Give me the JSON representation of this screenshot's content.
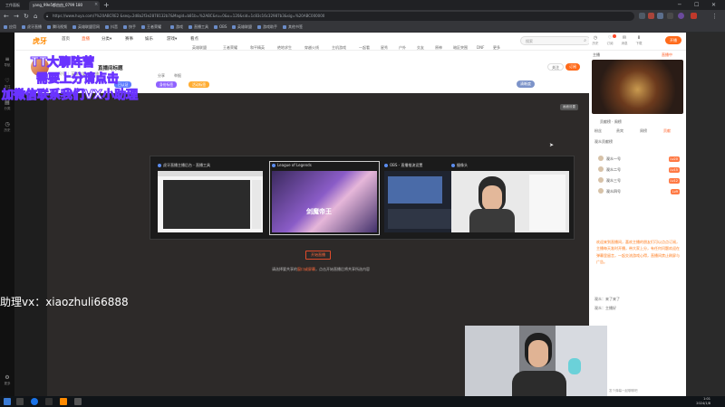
{
  "browser": {
    "tabs": [
      {
        "label": "工作面板"
      },
      {
        "label": "yang_99e5都由由_0799 180"
      }
    ],
    "new_tab": "+",
    "window_controls": {
      "min": "─",
      "max": "☐",
      "close": "✕"
    },
    "url": "https://www.huya.com/?%20ABCRE2 &seq=2d8a2f3e2878132b7&Magid=b81b=%2ABC&ru=0&u=120&sid=1c83c16c32987b3&sig=%20ABC000000",
    "nav": {
      "back": "←",
      "forward": "→",
      "reload": "↻",
      "home": "⌂"
    }
  },
  "bookmarks": [
    "应用",
    "虎牙直播",
    "腾讯视频",
    "英雄联盟官网",
    "抖音",
    "快手",
    "王者荣耀",
    "游戏",
    "直播工具",
    "OBS",
    "英雄联盟",
    "游戏助手",
    "其他书签"
  ],
  "leftrail": {
    "items": [
      {
        "icon": "≡",
        "label": "导航"
      },
      {
        "icon": "♡",
        "label": "关注"
      },
      {
        "icon": "▤",
        "label": "分类"
      },
      {
        "icon": "◷",
        "label": "历史"
      }
    ],
    "bottom": {
      "icon": "⚙",
      "label": "更多"
    }
  },
  "site": {
    "logo": "虎牙",
    "nav": [
      {
        "label": "首页"
      },
      {
        "label": "直播",
        "hot": true
      },
      {
        "label": "分类▾"
      },
      {
        "label": "赛事"
      },
      {
        "label": "娱乐"
      },
      {
        "label": "游戏▾"
      },
      {
        "label": "看点"
      }
    ],
    "categories": [
      "英雄联盟",
      "王者荣耀",
      "和平精英",
      "绝地求生",
      "穿越火线",
      "主机游戏",
      "一起看",
      "星秀",
      "户外",
      "交友",
      "原神",
      "暗区突围",
      "DNF",
      "更多"
    ],
    "search_placeholder": "搜索",
    "search_icon": "⌕",
    "top_icons": [
      {
        "glyph": "◷",
        "label": "历史"
      },
      {
        "glyph": "♡",
        "label": "订阅"
      },
      {
        "glyph": "✉",
        "label": "消息"
      },
      {
        "glyph": "⬇",
        "label": "下载"
      }
    ],
    "open_live": "开播",
    "login": "登录"
  },
  "room": {
    "title": "直播间标题",
    "meta": "房间号 ｜ 英雄联盟 ｜ 主播",
    "badges": [
      {
        "label": "已认证",
        "color": "#5b7cff"
      },
      {
        "label": "身份标签",
        "color": "#8f62ff"
      },
      {
        "label": "活动标签",
        "color": "#ffad33"
      }
    ],
    "actions": [
      "分享",
      "举报"
    ],
    "follow": "订阅",
    "subscribe": "关注",
    "stats": "清晰度"
  },
  "player": {
    "corner_label": "画面设置",
    "windows": [
      {
        "title": "虎牙直播主播后台 - 直播工具",
        "selected": false
      },
      {
        "title": "League of Legends",
        "selected": true
      },
      {
        "title": "OBS - 直播推流设置",
        "selected": false
      },
      {
        "title": "摄像头",
        "selected": false
      }
    ],
    "thumb_text": "剑魔帝王",
    "start_button": "开始直播",
    "hint_prefix": "请选择要共享的",
    "hint_highlight": "窗口或屏幕",
    "hint_suffix": "，点击开始直播后将共享所选内容"
  },
  "rightcol": {
    "top_row": [
      "主播",
      "直播中"
    ],
    "rank_header": "贡献榜 · 周榜",
    "tabs": [
      {
        "label": "粉丝",
        "on": false
      },
      {
        "label": "贵宾",
        "on": false
      },
      {
        "label": "周榜",
        "on": false
      },
      {
        "label": "贡献",
        "on": true
      }
    ],
    "rank_title": "观众贡献榜",
    "rank_items": [
      {
        "name": "观众一号",
        "tag": "Lv20"
      },
      {
        "name": "观众二号",
        "tag": "Lv15"
      },
      {
        "name": "观众三号",
        "tag": "Lv12"
      },
      {
        "name": "观众四号",
        "tag": "Lv9"
      }
    ],
    "announcement": "欢迎来到直播间，喜欢主播的朋友们可以点点订阅，主播每天准时开播，带大家上分，有任何问题欢迎在弹幕里留言，一起交流游戏心得，直播间禁止刷屏与广告。",
    "chat": [
      "观众：来了来了",
      "观众：主播好"
    ],
    "input_placeholder": "发个弹幕一起聊聊吧"
  },
  "overlays": {
    "line1": "TT大聊阵营",
    "line2": "需要上分请点击",
    "line3": "加微信联系我们VX小助理",
    "wechat": "助理vx：xiaozhuli66888"
  },
  "taskbar": {
    "time": "1:01",
    "date": "2024/1/8"
  }
}
